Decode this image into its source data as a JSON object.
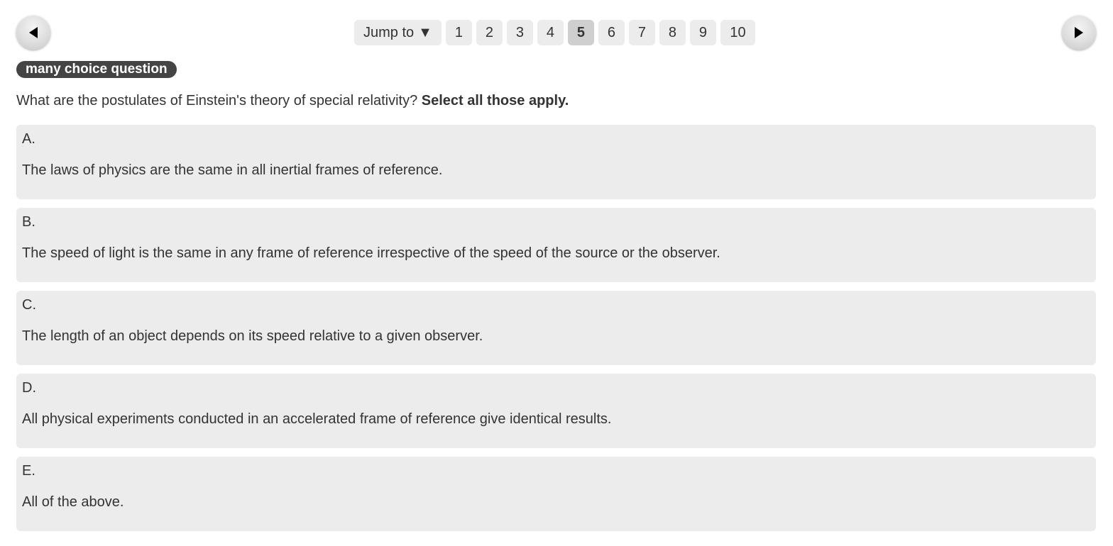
{
  "navigation": {
    "prev_icon": "triangle-left-icon",
    "next_icon": "triangle-right-icon",
    "jump_label": "Jump to",
    "jump_caret": "▼",
    "pages": [
      "1",
      "2",
      "3",
      "4",
      "5",
      "6",
      "7",
      "8",
      "9",
      "10"
    ],
    "current_page": "5"
  },
  "question": {
    "type_badge": "many choice question",
    "prompt": "What are the postulates of Einstein's theory of special relativity?",
    "instruction": "Select all those apply."
  },
  "options": [
    {
      "letter": "A.",
      "text": "The laws of physics are the same in all inertial frames of reference."
    },
    {
      "letter": "B.",
      "text": "The speed of light is the same in any frame of reference irrespective of the speed of the source or the observer."
    },
    {
      "letter": "C.",
      "text": "The length of an object depends on its speed relative to a given observer."
    },
    {
      "letter": "D.",
      "text": "All physical experiments conducted in an accelerated frame of reference give identical results."
    },
    {
      "letter": "E.",
      "text": "All of the above."
    }
  ],
  "colors": {
    "badge_bg": "#444444",
    "option_bg": "#ececec",
    "active_page_bg": "#cfcfcf",
    "text": "#333333"
  }
}
